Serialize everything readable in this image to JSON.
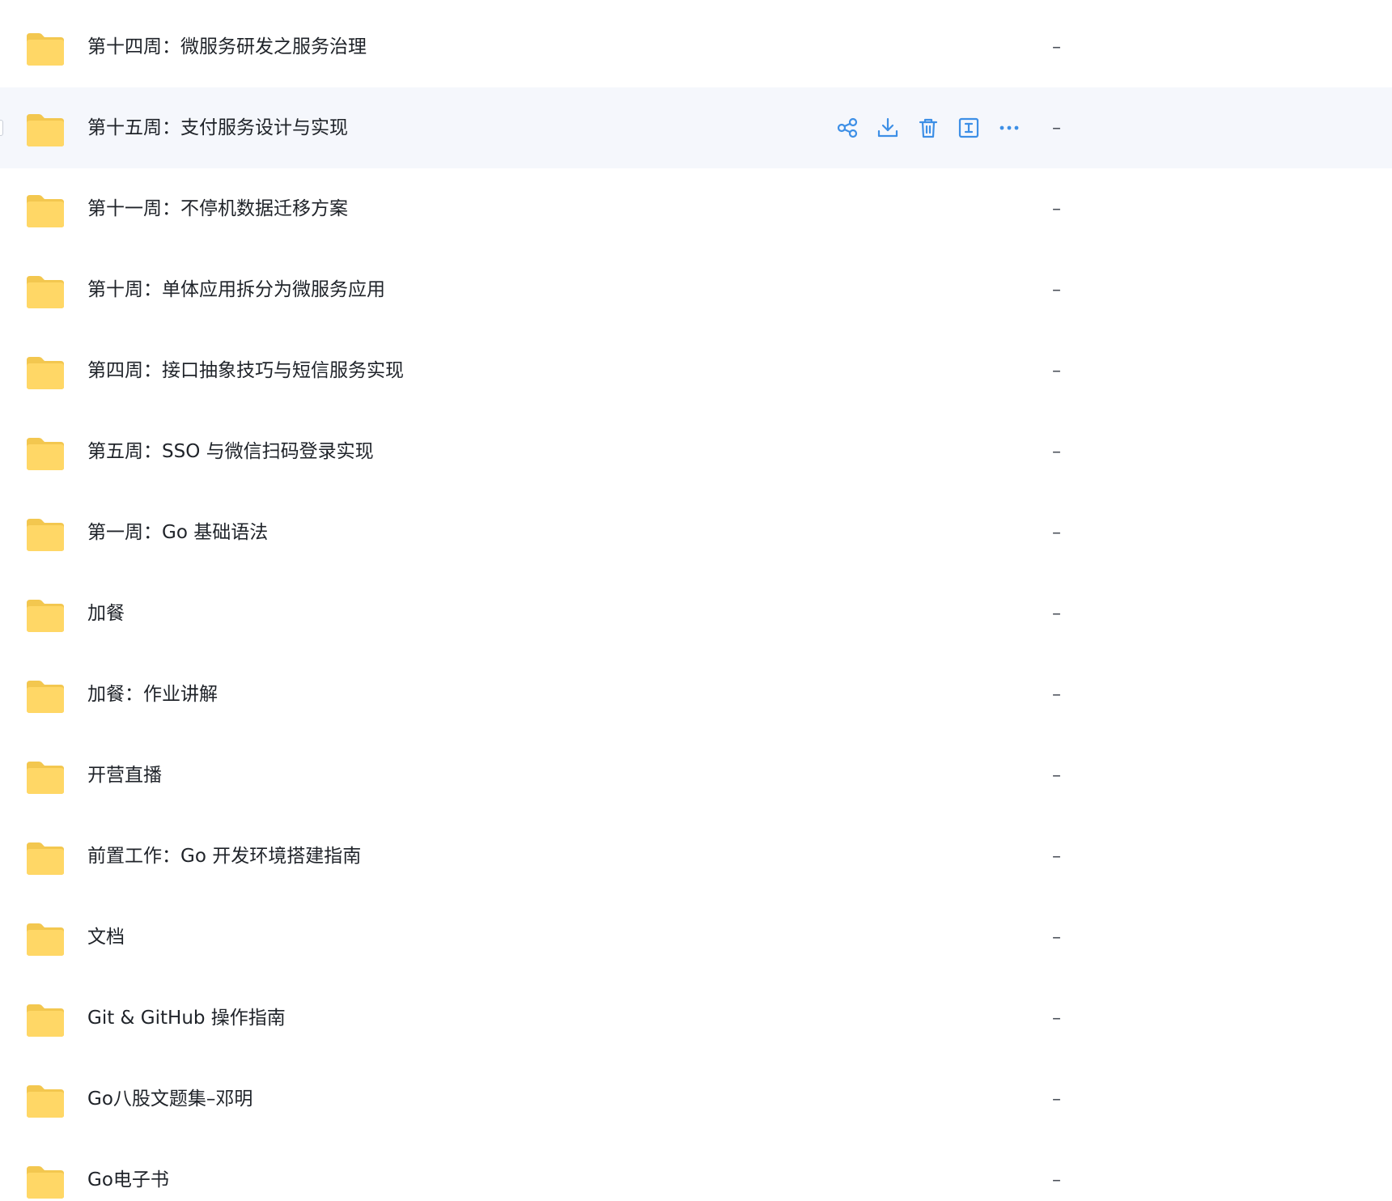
{
  "colors": {
    "folder_back": "#f3c74f",
    "folder_front": "#ffd766",
    "action_icon": "#3d8fe6",
    "hover_row": "#f5f7fc",
    "text": "#1f2329"
  },
  "file_list": {
    "rows": [
      {
        "name": "第十四周：微服务研发之服务治理",
        "size": "–",
        "icon": "folder-icon"
      },
      {
        "name": "第十五周：支付服务设计与实现",
        "size": "–",
        "icon": "folder-icon",
        "hovered": true
      },
      {
        "name": "第十一周：不停机数据迁移方案",
        "size": "–",
        "icon": "folder-icon"
      },
      {
        "name": "第十周：单体应用拆分为微服务应用",
        "size": "–",
        "icon": "folder-icon"
      },
      {
        "name": "第四周：接口抽象技巧与短信服务实现",
        "size": "–",
        "icon": "folder-icon"
      },
      {
        "name": "第五周：SSO 与微信扫码登录实现",
        "size": "–",
        "icon": "folder-icon"
      },
      {
        "name": "第一周：Go 基础语法",
        "size": "–",
        "icon": "folder-icon"
      },
      {
        "name": "加餐",
        "size": "–",
        "icon": "folder-icon"
      },
      {
        "name": "加餐：作业讲解",
        "size": "–",
        "icon": "folder-icon"
      },
      {
        "name": "开营直播",
        "size": "–",
        "icon": "folder-icon"
      },
      {
        "name": "前置工作：Go 开发环境搭建指南",
        "size": "–",
        "icon": "folder-icon"
      },
      {
        "name": "文档",
        "size": "–",
        "icon": "folder-icon"
      },
      {
        "name": "Git & GitHub 操作指南",
        "size": "–",
        "icon": "folder-icon"
      },
      {
        "name": "Go八股文题集–邓明",
        "size": "–",
        "icon": "folder-icon"
      },
      {
        "name": "Go电子书",
        "size": "–",
        "icon": "folder-icon"
      }
    ],
    "hover_actions": [
      {
        "id": "share",
        "icon": "share-icon"
      },
      {
        "id": "download",
        "icon": "download-icon"
      },
      {
        "id": "delete",
        "icon": "trash-icon"
      },
      {
        "id": "rename",
        "icon": "rename-icon"
      },
      {
        "id": "more",
        "icon": "more-icon"
      }
    ]
  }
}
